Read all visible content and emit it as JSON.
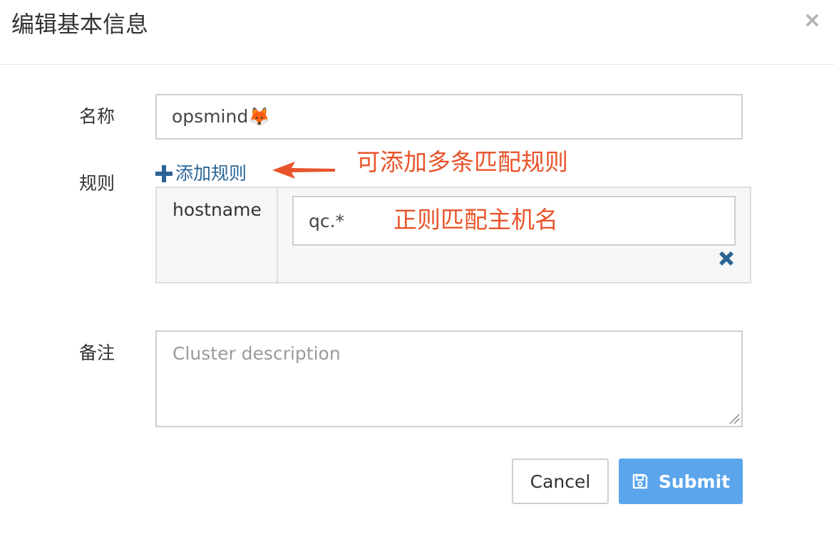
{
  "dialog": {
    "title": "编辑基本信息",
    "close_glyph": "×"
  },
  "form": {
    "name": {
      "label": "名称",
      "value": "opsmind🦊"
    },
    "rules": {
      "label": "规则",
      "add_link": "添加规则",
      "items": [
        {
          "key": "hostname",
          "value": "qc.*"
        }
      ]
    },
    "note": {
      "label": "备注",
      "placeholder": "Cluster description",
      "value": ""
    }
  },
  "annotations": {
    "add_rule_hint": "可添加多条匹配规则",
    "regex_hint": "正则匹配主机名",
    "color": "#e8542b"
  },
  "buttons": {
    "cancel": "Cancel",
    "submit": "Submit"
  },
  "colors": {
    "primary": "#5aa5ec",
    "link": "#2a6496",
    "annotation": "#e8542b"
  },
  "icons": {
    "close": "close-icon",
    "add": "plus-icon",
    "remove": "remove-x-icon",
    "save": "floppy-disk-icon"
  }
}
